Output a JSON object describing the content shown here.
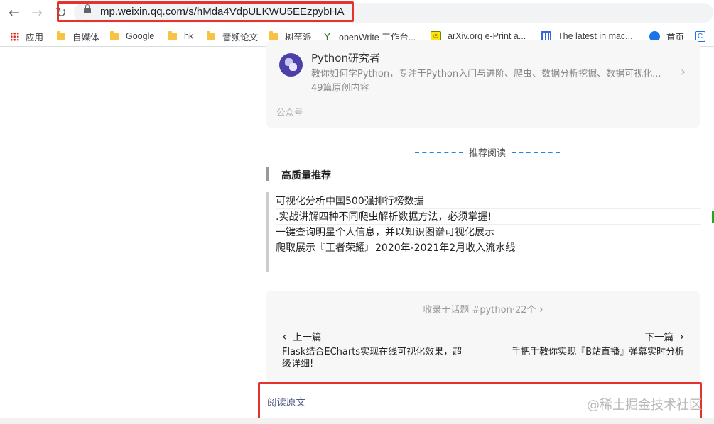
{
  "browser": {
    "url": "mp.weixin.qq.com/s/hMda4VdpULKWU5EEzpybHA",
    "back_icon": "arrow-left-icon",
    "forward_icon": "arrow-right-icon",
    "reload_icon": "reload-icon",
    "highlight_color": "#e5322d"
  },
  "bookmarks": [
    {
      "label": "应用",
      "icon": "apps-grid-icon"
    },
    {
      "label": "自媒体",
      "icon": "folder-icon"
    },
    {
      "label": "Google",
      "icon": "folder-icon"
    },
    {
      "label": "hk",
      "icon": "folder-icon"
    },
    {
      "label": "音频论文",
      "icon": "folder-icon"
    },
    {
      "label": "树莓派",
      "icon": "folder-icon"
    },
    {
      "label": "openWrite 工作台...",
      "icon": "openwrite-icon"
    },
    {
      "label": "arXiv.org e-Print a...",
      "icon": "smiley-icon"
    },
    {
      "label": "The latest in mac...",
      "icon": "chart-icon"
    },
    {
      "label": "首页",
      "icon": "graduation-icon"
    },
    {
      "label": "C",
      "icon": "c-icon"
    }
  ],
  "account": {
    "name": "Python研究者",
    "description": "教你如何学Python，专注于Python入门与进阶、爬虫、数据分析挖掘、数据可视化...",
    "count": "49篇原创内容",
    "type": "公众号"
  },
  "recommend": {
    "heading": "推荐阅读",
    "section": "高质量推荐",
    "links": [
      "可视化分析中国500强排行榜数据",
      ".实战讲解四种不同爬虫解析数据方法，必须掌握!",
      "一键查询明星个人信息，并以知识图谱可视化展示",
      "爬取展示『王者荣耀』2020年-2021年2月收入流水线"
    ]
  },
  "navigation": {
    "topic": "收录于话题 #python·22个",
    "prev_label": "上一篇",
    "next_label": "下一篇",
    "prev_title": "Flask结合ECharts实现在线可视化效果，超级详细!",
    "next_title": "手把手教你实现『B站直播』弹幕实时分析"
  },
  "read_more": "阅读原文",
  "watermark": "@稀土掘金技术社区"
}
